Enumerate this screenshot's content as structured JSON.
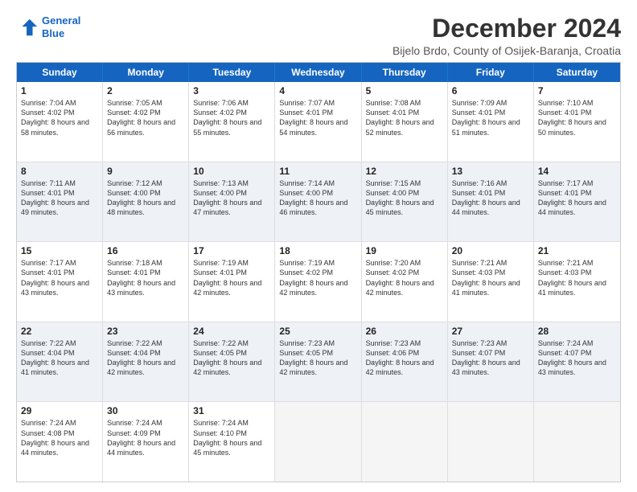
{
  "logo": {
    "line1": "General",
    "line2": "Blue"
  },
  "title": "December 2024",
  "location": "Bijelo Brdo, County of Osijek-Baranja, Croatia",
  "days_of_week": [
    "Sunday",
    "Monday",
    "Tuesday",
    "Wednesday",
    "Thursday",
    "Friday",
    "Saturday"
  ],
  "weeks": [
    [
      {
        "day": "1",
        "sunrise": "7:04 AM",
        "sunset": "4:02 PM",
        "daylight": "8 hours and 58 minutes.",
        "empty": false
      },
      {
        "day": "2",
        "sunrise": "7:05 AM",
        "sunset": "4:02 PM",
        "daylight": "8 hours and 56 minutes.",
        "empty": false
      },
      {
        "day": "3",
        "sunrise": "7:06 AM",
        "sunset": "4:02 PM",
        "daylight": "8 hours and 55 minutes.",
        "empty": false
      },
      {
        "day": "4",
        "sunrise": "7:07 AM",
        "sunset": "4:01 PM",
        "daylight": "8 hours and 54 minutes.",
        "empty": false
      },
      {
        "day": "5",
        "sunrise": "7:08 AM",
        "sunset": "4:01 PM",
        "daylight": "8 hours and 52 minutes.",
        "empty": false
      },
      {
        "day": "6",
        "sunrise": "7:09 AM",
        "sunset": "4:01 PM",
        "daylight": "8 hours and 51 minutes.",
        "empty": false
      },
      {
        "day": "7",
        "sunrise": "7:10 AM",
        "sunset": "4:01 PM",
        "daylight": "8 hours and 50 minutes.",
        "empty": false
      }
    ],
    [
      {
        "day": "8",
        "sunrise": "7:11 AM",
        "sunset": "4:01 PM",
        "daylight": "8 hours and 49 minutes.",
        "empty": false
      },
      {
        "day": "9",
        "sunrise": "7:12 AM",
        "sunset": "4:00 PM",
        "daylight": "8 hours and 48 minutes.",
        "empty": false
      },
      {
        "day": "10",
        "sunrise": "7:13 AM",
        "sunset": "4:00 PM",
        "daylight": "8 hours and 47 minutes.",
        "empty": false
      },
      {
        "day": "11",
        "sunrise": "7:14 AM",
        "sunset": "4:00 PM",
        "daylight": "8 hours and 46 minutes.",
        "empty": false
      },
      {
        "day": "12",
        "sunrise": "7:15 AM",
        "sunset": "4:00 PM",
        "daylight": "8 hours and 45 minutes.",
        "empty": false
      },
      {
        "day": "13",
        "sunrise": "7:16 AM",
        "sunset": "4:01 PM",
        "daylight": "8 hours and 44 minutes.",
        "empty": false
      },
      {
        "day": "14",
        "sunrise": "7:17 AM",
        "sunset": "4:01 PM",
        "daylight": "8 hours and 44 minutes.",
        "empty": false
      }
    ],
    [
      {
        "day": "15",
        "sunrise": "7:17 AM",
        "sunset": "4:01 PM",
        "daylight": "8 hours and 43 minutes.",
        "empty": false
      },
      {
        "day": "16",
        "sunrise": "7:18 AM",
        "sunset": "4:01 PM",
        "daylight": "8 hours and 43 minutes.",
        "empty": false
      },
      {
        "day": "17",
        "sunrise": "7:19 AM",
        "sunset": "4:01 PM",
        "daylight": "8 hours and 42 minutes.",
        "empty": false
      },
      {
        "day": "18",
        "sunrise": "7:19 AM",
        "sunset": "4:02 PM",
        "daylight": "8 hours and 42 minutes.",
        "empty": false
      },
      {
        "day": "19",
        "sunrise": "7:20 AM",
        "sunset": "4:02 PM",
        "daylight": "8 hours and 42 minutes.",
        "empty": false
      },
      {
        "day": "20",
        "sunrise": "7:21 AM",
        "sunset": "4:03 PM",
        "daylight": "8 hours and 41 minutes.",
        "empty": false
      },
      {
        "day": "21",
        "sunrise": "7:21 AM",
        "sunset": "4:03 PM",
        "daylight": "8 hours and 41 minutes.",
        "empty": false
      }
    ],
    [
      {
        "day": "22",
        "sunrise": "7:22 AM",
        "sunset": "4:04 PM",
        "daylight": "8 hours and 41 minutes.",
        "empty": false
      },
      {
        "day": "23",
        "sunrise": "7:22 AM",
        "sunset": "4:04 PM",
        "daylight": "8 hours and 42 minutes.",
        "empty": false
      },
      {
        "day": "24",
        "sunrise": "7:22 AM",
        "sunset": "4:05 PM",
        "daylight": "8 hours and 42 minutes.",
        "empty": false
      },
      {
        "day": "25",
        "sunrise": "7:23 AM",
        "sunset": "4:05 PM",
        "daylight": "8 hours and 42 minutes.",
        "empty": false
      },
      {
        "day": "26",
        "sunrise": "7:23 AM",
        "sunset": "4:06 PM",
        "daylight": "8 hours and 42 minutes.",
        "empty": false
      },
      {
        "day": "27",
        "sunrise": "7:23 AM",
        "sunset": "4:07 PM",
        "daylight": "8 hours and 43 minutes.",
        "empty": false
      },
      {
        "day": "28",
        "sunrise": "7:24 AM",
        "sunset": "4:07 PM",
        "daylight": "8 hours and 43 minutes.",
        "empty": false
      }
    ],
    [
      {
        "day": "29",
        "sunrise": "7:24 AM",
        "sunset": "4:08 PM",
        "daylight": "8 hours and 44 minutes.",
        "empty": false
      },
      {
        "day": "30",
        "sunrise": "7:24 AM",
        "sunset": "4:09 PM",
        "daylight": "8 hours and 44 minutes.",
        "empty": false
      },
      {
        "day": "31",
        "sunrise": "7:24 AM",
        "sunset": "4:10 PM",
        "daylight": "8 hours and 45 minutes.",
        "empty": false
      },
      {
        "day": "",
        "empty": true
      },
      {
        "day": "",
        "empty": true
      },
      {
        "day": "",
        "empty": true
      },
      {
        "day": "",
        "empty": true
      }
    ]
  ]
}
